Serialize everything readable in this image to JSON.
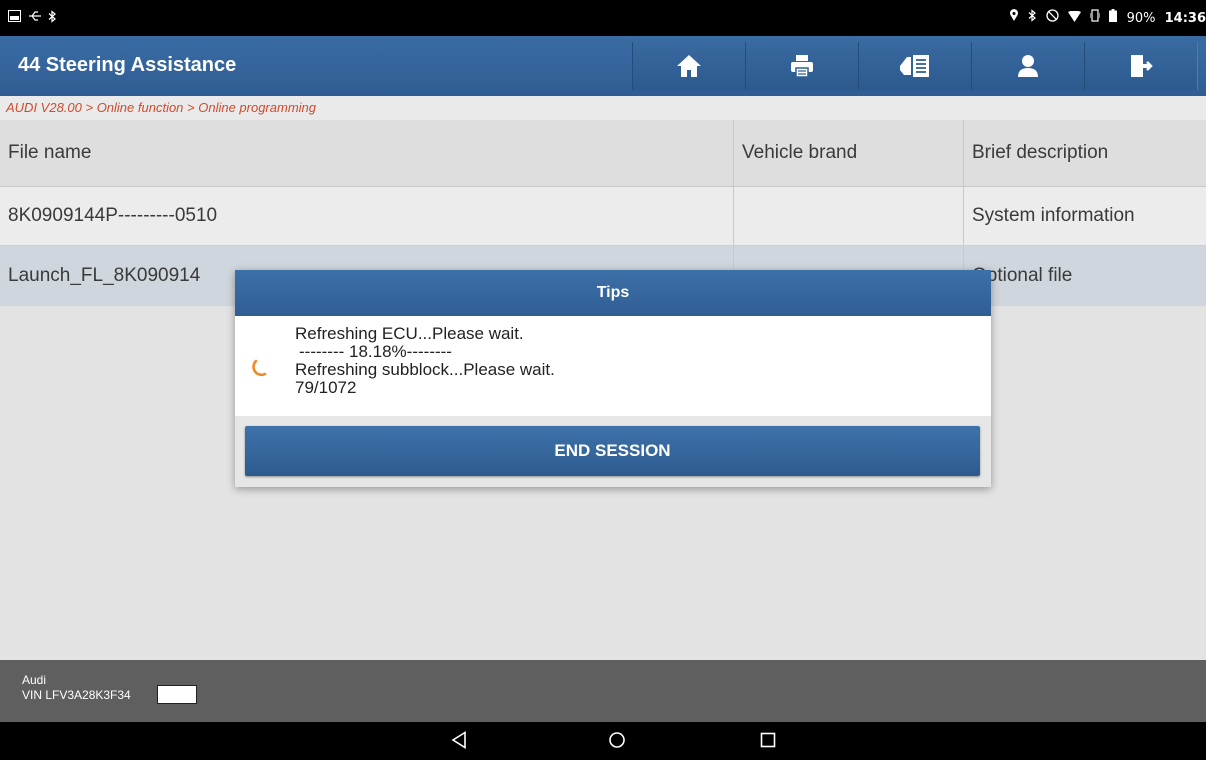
{
  "status_bar": {
    "left_icons": [
      "screenshot-icon",
      "usb-icon",
      "bluetooth-icon"
    ],
    "right_icons": [
      "location-icon",
      "bluetooth-icon",
      "do-not-disturb-icon",
      "wifi-icon",
      "vibrate-icon",
      "battery-icon"
    ],
    "battery": "90%",
    "time": "14:36"
  },
  "header": {
    "title": "44 Steering Assistance",
    "buttons": [
      "home-icon",
      "print-icon",
      "report-icon",
      "user-icon",
      "exit-icon"
    ]
  },
  "breadcrumb": "AUDI V28.00 > Online function > Online programming",
  "table": {
    "columns": [
      "File name",
      "Vehicle brand",
      "Brief description"
    ],
    "rows": [
      {
        "file": "8K0909144P---------0510",
        "brand": "",
        "description": "System information"
      },
      {
        "file": "Launch_FL_8K090914",
        "brand": "",
        "description": "Optional file"
      }
    ]
  },
  "dialog": {
    "title": "Tips",
    "line1": "Refreshing ECU...Please wait.",
    "line2": "-------- 18.18%--------",
    "line3": "Refreshing subblock...Please wait.",
    "line4": "79/1072",
    "button": "END SESSION",
    "progress_percent": 18.18,
    "spinner_color": "#f08a24"
  },
  "footer": {
    "make": "Audi",
    "vin": "VIN LFV3A28K3F34"
  },
  "nav_bar": {
    "buttons": [
      "back-icon",
      "home-circle-icon",
      "recents-icon"
    ]
  },
  "colors": {
    "header_blue": "#3568a0",
    "breadcrumb_text": "#cf4b2c",
    "selected_row": "#cfd6dd"
  }
}
